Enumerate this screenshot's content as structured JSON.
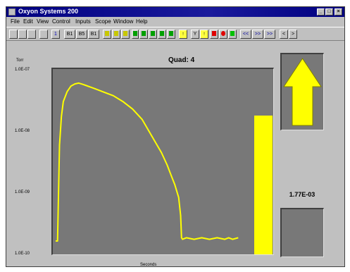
{
  "window": {
    "title": "Oxyon Systems 200",
    "controls": [
      "_",
      "□",
      "×"
    ]
  },
  "menu": [
    "File",
    "Edit",
    "View",
    "Control",
    "Inputs",
    "Scope",
    "Window",
    "Help"
  ],
  "toolbar": {
    "buttons": [
      "",
      "",
      "",
      "",
      "1",
      "B1",
      "B5",
      "B1",
      "",
      "",
      "",
      "",
      "",
      "",
      "",
      "",
      "",
      "",
      "",
      "",
      "",
      "",
      "",
      "<<",
      ">>",
      ">>",
      "<",
      ">"
    ],
    "colors": {
      "yellow": "#ffff00",
      "green": "#00c000",
      "red": "#ff0000",
      "blue": "#0000ff",
      "grey": "#c0c0c0"
    }
  },
  "quad_label": "Quad: 4",
  "y_unit": "Torr",
  "x_axis_label": "Seconds",
  "readout_value": "1.77E-03",
  "trend": {
    "direction": "up",
    "arrow_color": "#ffff00"
  },
  "level_bar": {
    "fraction": 0.75,
    "color": "#ffff00"
  },
  "chart_data": {
    "type": "line",
    "title": "Quad: 4",
    "ylabel": "Torr",
    "xlabel": "Seconds",
    "y_scale": "log",
    "ylim": [
      1e-10,
      1e-07
    ],
    "y_ticks": [
      "1.0E-07",
      "1.0E-08",
      "1.0E-09",
      "1.0E-10"
    ],
    "x_range": [
      0,
      100
    ],
    "series": [
      {
        "color": "#ffff00",
        "x": [
          0,
          1,
          2,
          3,
          4,
          6,
          8,
          10,
          12,
          14,
          16,
          20,
          25,
          30,
          35,
          40,
          45,
          50,
          55,
          58,
          60,
          62,
          64,
          65,
          65.5,
          66,
          68,
          72,
          76,
          80,
          84,
          88,
          90,
          92,
          95
        ],
        "y": [
          1.5e-10,
          1.5e-10,
          6e-09,
          1.8e-08,
          3.2e-08,
          4.7e-08,
          5.8e-08,
          6.3e-08,
          6.5e-08,
          6.2e-08,
          5.9e-08,
          5.3e-08,
          4.6e-08,
          4e-08,
          3.2e-08,
          2.4e-08,
          1.6e-08,
          8.5e-09,
          4.5e-09,
          2.8e-09,
          1.9e-09,
          1.3e-09,
          8e-10,
          4e-10,
          1.7e-10,
          1.6e-10,
          1.7e-10,
          1.6e-10,
          1.7e-10,
          1.6e-10,
          1.7e-10,
          1.6e-10,
          1.7e-10,
          1.6e-10,
          1.7e-10
        ]
      }
    ]
  }
}
